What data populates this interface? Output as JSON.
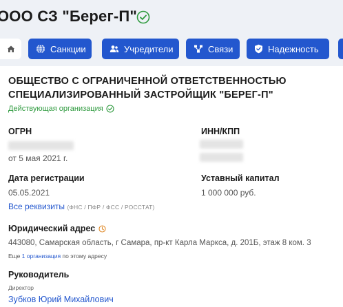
{
  "header": {
    "title": "ООО СЗ \"Берег-П\""
  },
  "nav": {
    "tabs": [
      {
        "label": "Санкции"
      },
      {
        "label": "Учредители"
      },
      {
        "label": "Связи"
      },
      {
        "label": "Надежность"
      }
    ]
  },
  "organization": {
    "full_name_line1": "ОБЩЕСТВО С ОГРАНИЧЕННОЙ ОТВЕТСТВЕННОСТЬЮ",
    "full_name_line2": "СПЕЦИАЛИЗИРОВАННЫЙ ЗАСТРОЙЩИК \"БЕРЕГ-П\"",
    "status": "Действующая организация"
  },
  "details": {
    "ogrn_label": "ОГРН",
    "ogrn_date": "от 5 мая 2021 г.",
    "inn_label": "ИНН/КПП",
    "reg_date_label": "Дата регистрации",
    "reg_date": "05.05.2021",
    "capital_label": "Уставный капитал",
    "capital": "1 000 000 руб.",
    "all_details_link": "Все реквизиты",
    "all_details_sources": "(ФНС / ПФР / ФСС / РОССТАТ)"
  },
  "address": {
    "label": "Юридический адрес",
    "value": "443080, Самарская область, г Самара, пр-кт Карла Маркса, д. 201Б, этаж 8 ком. 3",
    "more_prefix": "Еще",
    "more_link": "1 организация",
    "more_suffix": "по этому адресу"
  },
  "management": {
    "label": "Руководитель",
    "role": "Директор",
    "name": "Зубков Юрий Михайлович"
  },
  "colors": {
    "accent": "#2357ce",
    "status_green": "#2e9a3e",
    "header_bg": "#eef1f6"
  }
}
